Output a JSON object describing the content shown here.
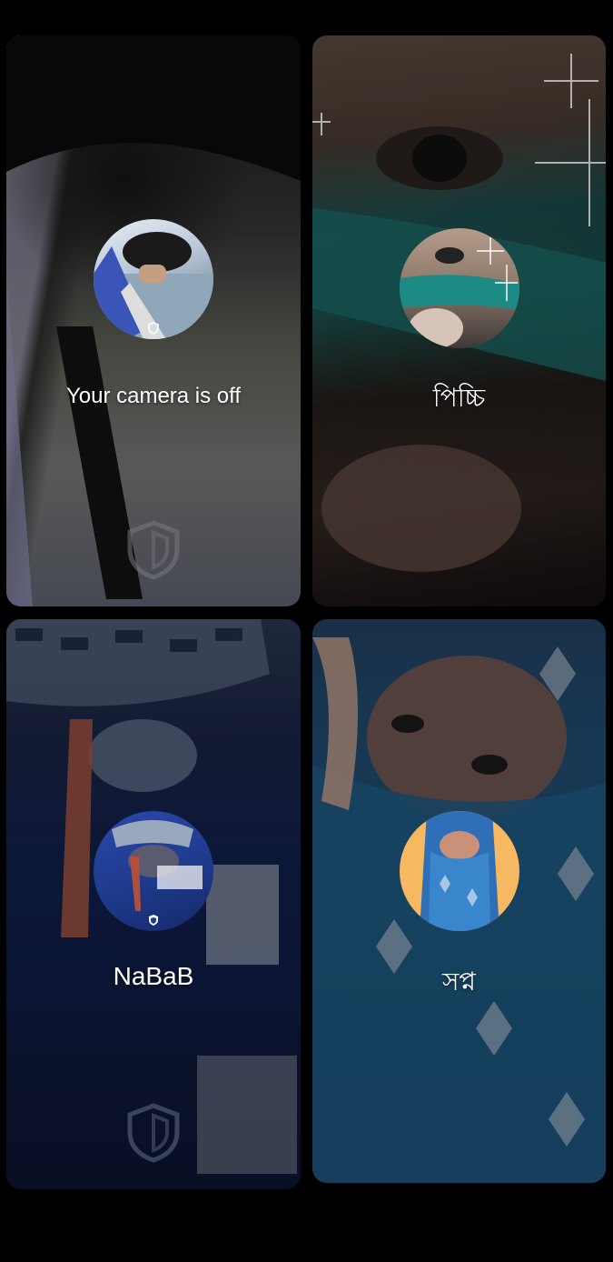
{
  "tiles": [
    {
      "id": "self",
      "label": "Your camera is off",
      "avatar_icon": "user-photo-avatar",
      "watermark_icon": "shield-icon"
    },
    {
      "id": "participant-2",
      "label": "পিচ্চি",
      "avatar_icon": "user-photo-avatar"
    },
    {
      "id": "participant-3",
      "label": "NaBaB",
      "avatar_icon": "user-photo-avatar",
      "watermark_icon": "shield-icon"
    },
    {
      "id": "participant-4",
      "label": "সপ্ন",
      "avatar_icon": "user-photo-avatar"
    }
  ],
  "colors": {
    "background": "#000000",
    "label": "#ffffff",
    "avatar_4_bg": "#f6b860"
  }
}
